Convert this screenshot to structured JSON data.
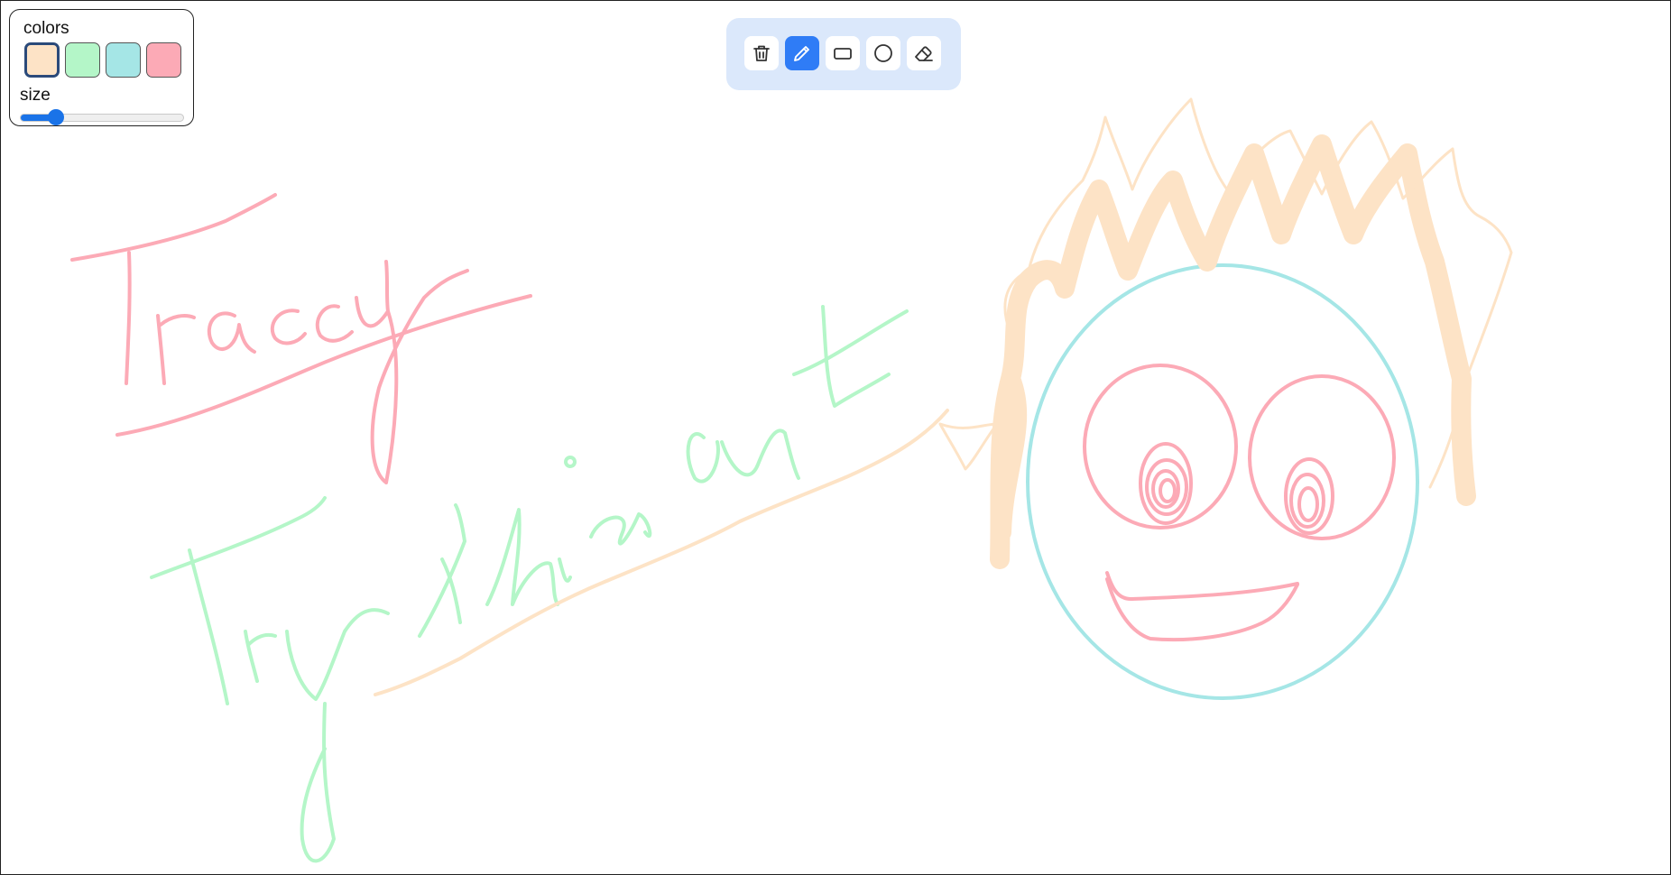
{
  "panel": {
    "colors_label": "colors",
    "size_label": "size",
    "swatches": [
      {
        "name": "peach",
        "color": "#fde3c6",
        "selected": true
      },
      {
        "name": "green",
        "color": "#b4f6c8",
        "selected": false
      },
      {
        "name": "teal",
        "color": "#a5e6e6",
        "selected": false
      },
      {
        "name": "pink",
        "color": "#fcaab6",
        "selected": false
      }
    ],
    "size_fraction": 0.22
  },
  "toolbar": {
    "tools": [
      {
        "name": "delete-button",
        "icon": "trash-icon",
        "active": false
      },
      {
        "name": "pencil-tool-button",
        "icon": "pencil-icon",
        "active": true
      },
      {
        "name": "rectangle-tool-button",
        "icon": "rectangle-icon",
        "active": false
      },
      {
        "name": "circle-tool-button",
        "icon": "circle-icon",
        "active": false
      },
      {
        "name": "eraser-tool-button",
        "icon": "eraser-icon",
        "active": false
      }
    ],
    "active_color": "#2f7cf6"
  },
  "canvas": {
    "colors": {
      "pink": "#fcaab6",
      "green": "#b4f6c8",
      "teal": "#a5e6e6",
      "peach": "#fde3c6"
    }
  }
}
